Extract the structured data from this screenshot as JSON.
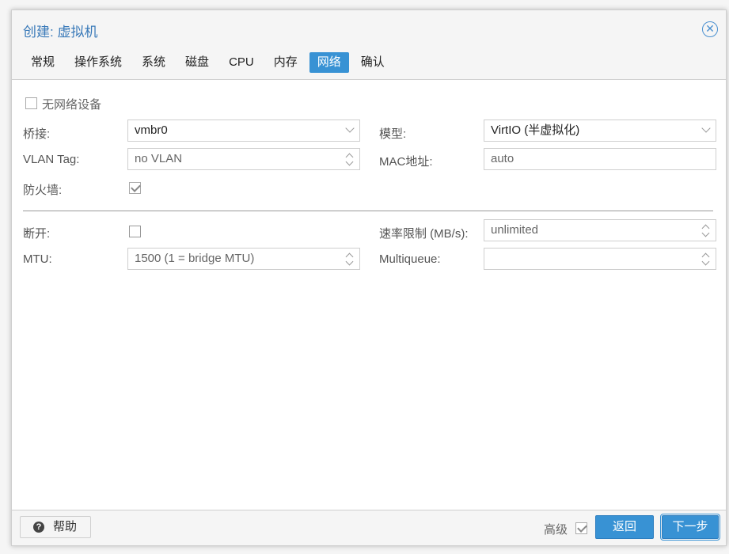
{
  "dialog": {
    "title": "创建: 虚拟机",
    "close_icon": "close-icon"
  },
  "tabs": [
    {
      "label": "常规",
      "active": false
    },
    {
      "label": "操作系统",
      "active": false
    },
    {
      "label": "系统",
      "active": false
    },
    {
      "label": "磁盘",
      "active": false
    },
    {
      "label": "CPU",
      "active": false
    },
    {
      "label": "内存",
      "active": false
    },
    {
      "label": "网络",
      "active": true
    },
    {
      "label": "确认",
      "active": false
    }
  ],
  "form": {
    "no_network": {
      "label": "无网络设备",
      "checked": false
    },
    "bridge": {
      "label": "桥接:",
      "value": "vmbr0"
    },
    "vlan_tag": {
      "label": "VLAN Tag:",
      "placeholder": "no VLAN"
    },
    "firewall": {
      "label": "防火墙:",
      "checked": true
    },
    "model": {
      "label": "模型:",
      "value": "VirtIO (半虚拟化)"
    },
    "mac": {
      "label": "MAC地址:",
      "placeholder": "auto"
    },
    "disconnect": {
      "label": "断开:",
      "checked": false
    },
    "mtu": {
      "label": "MTU:",
      "placeholder": "1500 (1 = bridge MTU)"
    },
    "rate_limit": {
      "label": "速率限制 (MB/s):",
      "placeholder": "unlimited"
    },
    "multiqueue": {
      "label": "Multiqueue:",
      "value": ""
    }
  },
  "footer": {
    "help_label": "帮助",
    "advanced_label": "高级",
    "advanced_checked": true,
    "back_label": "返回",
    "next_label": "下一步"
  },
  "colors": {
    "accent": "#3892d4",
    "title": "#3a7ab9"
  }
}
